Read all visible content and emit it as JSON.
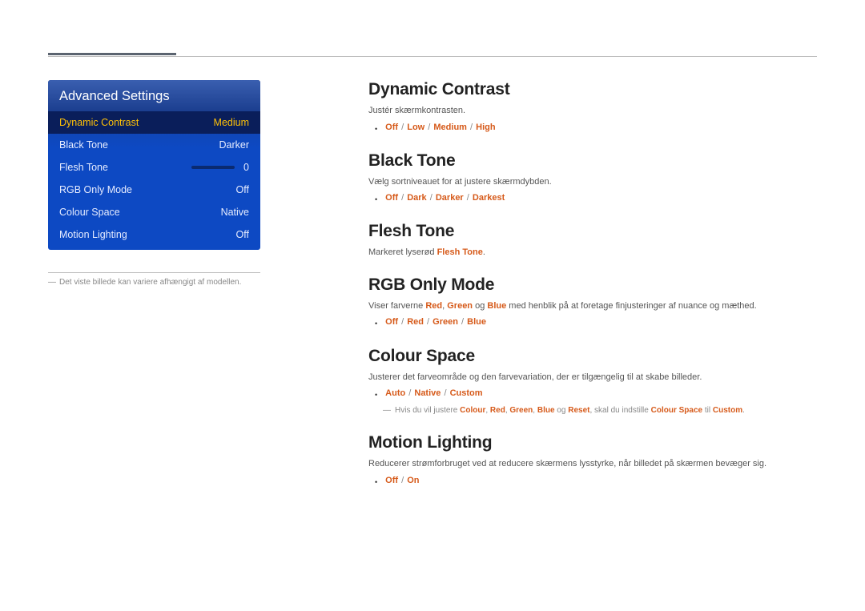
{
  "menu": {
    "title": "Advanced Settings",
    "rows": [
      {
        "label": "Dynamic Contrast",
        "value": "Medium"
      },
      {
        "label": "Black Tone",
        "value": "Darker"
      },
      {
        "label": "Flesh Tone",
        "value": "0"
      },
      {
        "label": "RGB Only Mode",
        "value": "Off"
      },
      {
        "label": "Colour Space",
        "value": "Native"
      },
      {
        "label": "Motion Lighting",
        "value": "Off"
      }
    ]
  },
  "footnote": "Det viste billede kan variere afhængigt af modellen.",
  "sections": {
    "dynamic_contrast": {
      "title": "Dynamic Contrast",
      "desc": "Justér skærmkontrasten.",
      "opts": [
        "Off",
        "Low",
        "Medium",
        "High"
      ]
    },
    "black_tone": {
      "title": "Black Tone",
      "desc": "Vælg sortniveauet for at justere skærmdybden.",
      "opts": [
        "Off",
        "Dark",
        "Darker",
        "Darkest"
      ]
    },
    "flesh_tone": {
      "title": "Flesh Tone",
      "desc_pre": "Markeret lyserød ",
      "desc_bold": "Flesh Tone",
      "desc_post": "."
    },
    "rgb_only": {
      "title": "RGB Only Mode",
      "desc_pre": "Viser farverne ",
      "c1": "Red",
      "c2": "Green",
      "c3": "Blue",
      "sep_comma": ", ",
      "sep_og": " og ",
      "desc_post": " med henblik på at foretage finjusteringer af nuance og mæthed.",
      "opts": [
        "Off",
        "Red",
        "Green",
        "Blue"
      ]
    },
    "colour_space": {
      "title": "Colour Space",
      "desc": "Justerer det farveområde og den farvevariation, der er tilgængelig til at skabe billeder.",
      "opts": [
        "Auto",
        "Native",
        "Custom"
      ],
      "note_pre": "Hvis du vil justere ",
      "n1": "Colour",
      "n2": "Red",
      "n3": "Green",
      "n4": "Blue",
      "n5": "Reset",
      "note_mid": ", skal du indstille ",
      "n6": "Colour Space",
      "note_til": " til ",
      "n7": "Custom",
      "note_end": "."
    },
    "motion_lighting": {
      "title": "Motion Lighting",
      "desc": "Reducerer strømforbruget ved at reducere skærmens lysstyrke, når billedet på skærmen bevæger sig.",
      "opts": [
        "Off",
        "On"
      ]
    }
  }
}
